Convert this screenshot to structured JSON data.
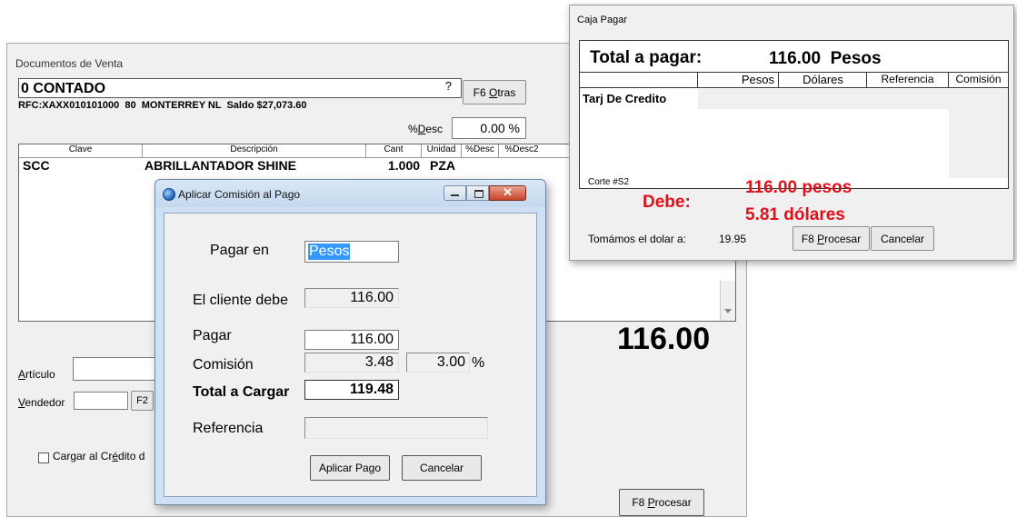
{
  "venta": {
    "title": "Documentos de Venta",
    "cliente": "0 CONTADO",
    "question": "?",
    "f6_prefix": "F6 ",
    "f6_u": "O",
    "f6_rest": "tras",
    "rfc_line": "RFC:XAXX010101000  80  MONTERREY NL  Saldo $27,073.60",
    "desc_prefix": "%",
    "desc_u": "D",
    "desc_rest": "esc",
    "desc_value": "0.00 %",
    "columns": [
      "Clave",
      "Descripción",
      "Cant",
      "Unidad",
      "%Desc",
      "%Desc2"
    ],
    "row": {
      "clave": "SCC",
      "descripcion": "ABRILLANTADOR SHINE",
      "cant": "1.000",
      "unidad": "PZA"
    },
    "total": "116.00",
    "articulo_u": "A",
    "articulo_rest": "rtículo",
    "vendedor_u": "V",
    "vendedor_rest": "endedor",
    "f2": "F2",
    "credito_pre": "Cargar al Cr",
    "credito_u": "é",
    "credito_rest": "dito d",
    "f8_prefix": "F8 ",
    "f8_u": "P",
    "f8_rest": "rocesar"
  },
  "comision": {
    "title": "Aplicar Comisión al Pago",
    "pagar_en_label": "Pagar en",
    "pagar_en_value": "Pesos",
    "cliente_debe_label": "El cliente debe",
    "cliente_debe_value": "116.00",
    "pagar_label": "Pagar",
    "pagar_value": "116.00",
    "comision_label": "Comisión",
    "comision_value": "3.48",
    "comision_pct": "3.00",
    "pct_sign": "%",
    "total_label": "Total a Cargar",
    "total_value": "119.48",
    "referencia_label": "Referencia",
    "referencia_value": "",
    "aplicar_label": "Aplicar Pago",
    "cancelar_label": "Cancelar"
  },
  "caja": {
    "title": "Caja Pagar",
    "total_label": "Total a pagar:",
    "total_value": "116.00  Pesos",
    "columns": [
      "Pesos",
      "Dólares",
      "Referencia",
      "Comisión"
    ],
    "rows": [
      "Tarj De Credito"
    ],
    "corte": "Corte #S2",
    "debe_label": "Debe:",
    "debe_pesos": "116.00 pesos",
    "debe_dolares": "5.81 dólares",
    "dolar_label": "Tomámos el dolar a:",
    "dolar_value": "19.95",
    "f8_prefix": "F8 ",
    "f8_u": "P",
    "f8_rest": "rocesar",
    "cancelar_label": "Cancelar"
  },
  "colors": {
    "red": "#e3101a",
    "selection": "#3399ff",
    "dialog_bg": "#f0f0f0"
  }
}
